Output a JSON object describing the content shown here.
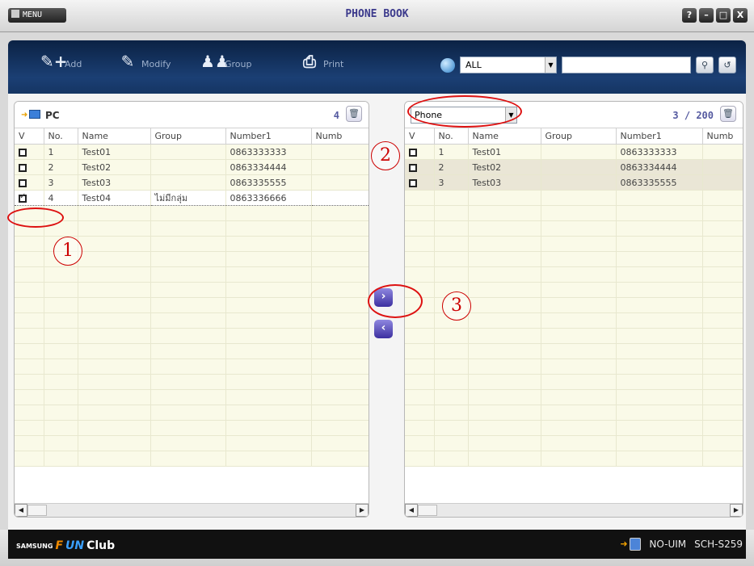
{
  "window": {
    "menu_label": "MENU",
    "title": "PHONE BOOK",
    "buttons": [
      "?",
      "–",
      "□",
      "X"
    ]
  },
  "toolbar": {
    "add_label": "Add",
    "modify_label": "Modify",
    "group_label": "Group",
    "print_label": "Print",
    "filter_value": "ALL",
    "search_value": ""
  },
  "left_panel": {
    "title": "PC",
    "count": "4",
    "columns": [
      "V",
      "No.",
      "Name",
      "Group",
      "Number1",
      "Numb"
    ],
    "rows": [
      {
        "checked": false,
        "no": "1",
        "name": "Test01",
        "group": "",
        "number1": "0863333333"
      },
      {
        "checked": false,
        "no": "2",
        "name": "Test02",
        "group": "",
        "number1": "0863334444"
      },
      {
        "checked": false,
        "no": "3",
        "name": "Test03",
        "group": "",
        "number1": "0863335555"
      },
      {
        "checked": true,
        "no": "4",
        "name": "Test04",
        "group": "ไม่มีกลุ่ม",
        "number1": "0863336666"
      }
    ]
  },
  "right_panel": {
    "source": "Phone",
    "count": "3 / 200",
    "columns": [
      "V",
      "No.",
      "Name",
      "Group",
      "Number1",
      "Numb"
    ],
    "rows": [
      {
        "checked": false,
        "no": "1",
        "name": "Test01",
        "group": "",
        "number1": "0863333333"
      },
      {
        "checked": false,
        "no": "2",
        "name": "Test02",
        "group": "",
        "number1": "0863334444"
      },
      {
        "checked": false,
        "no": "3",
        "name": "Test03",
        "group": "",
        "number1": "0863335555"
      }
    ]
  },
  "transfer": {
    "to_phone": "›",
    "to_pc": "‹"
  },
  "annotations": [
    "1",
    "2",
    "3"
  ],
  "status": {
    "brand_prefix": "SAMSUNG",
    "brand_fun1": "F",
    "brand_fun2": "UN",
    "brand_suffix": "Club",
    "uim": "NO-UIM",
    "model": "SCH-S259"
  },
  "colors": {
    "toolbar_bg": "#153563",
    "title": "#3c3a8c",
    "annotation": "#cc0000",
    "row_bg": "#fafae8",
    "row_alt_bg": "#eae6d6"
  },
  "icons": [
    "menu-icon",
    "add-contact-icon",
    "modify-contact-icon",
    "group-icon",
    "print-icon",
    "search-icon",
    "search-go-icon",
    "refresh-icon",
    "pc-icon",
    "trash-icon",
    "phone-icon"
  ]
}
